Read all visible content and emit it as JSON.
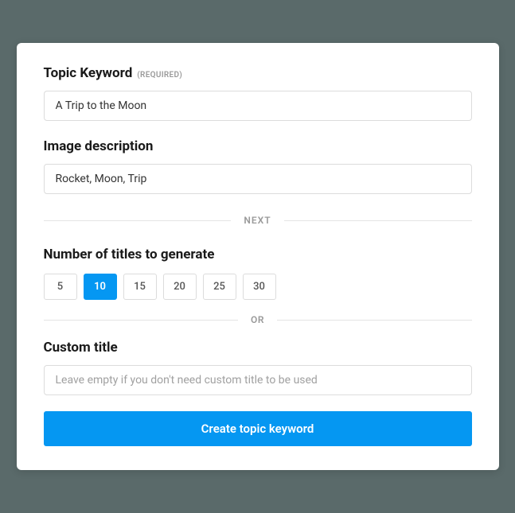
{
  "topicKeyword": {
    "label": "Topic Keyword",
    "requiredTag": "(REQUIRED)",
    "value": "A Trip to the Moon"
  },
  "imageDescription": {
    "label": "Image description",
    "value": "Rocket, Moon, Trip"
  },
  "dividerNext": "NEXT",
  "titlesCount": {
    "label": "Number of titles to generate",
    "options": [
      "5",
      "10",
      "15",
      "20",
      "25",
      "30"
    ],
    "selected": "10"
  },
  "dividerOr": "OR",
  "customTitle": {
    "label": "Custom title",
    "placeholder": "Leave empty if you don't need custom title to be used",
    "value": ""
  },
  "submitLabel": "Create topic keyword"
}
